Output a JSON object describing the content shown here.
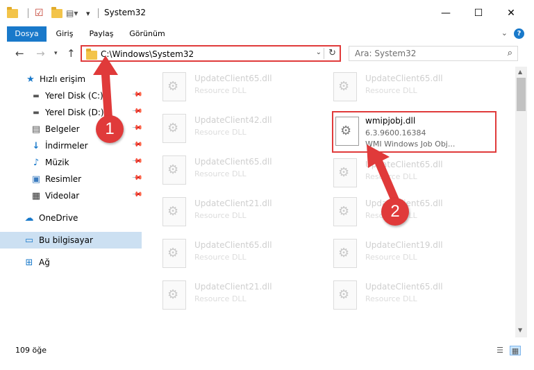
{
  "window": {
    "title": "System32",
    "minimize_glyph": "—",
    "maximize_glyph": "☐",
    "close_glyph": "✕"
  },
  "ribbon": {
    "tabs": [
      {
        "label": "Dosya",
        "active": true
      },
      {
        "label": "Giriş"
      },
      {
        "label": "Paylaş"
      },
      {
        "label": "Görünüm"
      }
    ],
    "help_glyph": "?",
    "collapse_glyph": "⌄"
  },
  "nav": {
    "address": "C:\\Windows\\System32",
    "search_placeholder": "Ara: System32"
  },
  "sidebar": {
    "items": [
      {
        "label": "Hızlı erişim",
        "icon": "star-icon",
        "pinned": false
      },
      {
        "label": "Yerel Disk (C:)",
        "icon": "drive-icon",
        "pinned": true
      },
      {
        "label": "Yerel Disk (D:)",
        "icon": "drive-icon",
        "pinned": true
      },
      {
        "label": "Belgeler",
        "icon": "documents-icon",
        "pinned": true
      },
      {
        "label": "İndirmeler",
        "icon": "download-icon",
        "pinned": true
      },
      {
        "label": "Müzik",
        "icon": "music-icon",
        "pinned": true
      },
      {
        "label": "Resimler",
        "icon": "pictures-icon",
        "pinned": true
      },
      {
        "label": "Videolar",
        "icon": "video-icon",
        "pinned": true
      },
      {
        "label": "OneDrive",
        "icon": "cloud-icon"
      },
      {
        "label": "Bu bilgisayar",
        "icon": "computer-icon",
        "selected": true
      },
      {
        "label": "Ağ",
        "icon": "network-icon"
      }
    ]
  },
  "files": [
    {
      "name": "UpdateClient65.dll",
      "desc": "Resource DLL"
    },
    {
      "name": "UpdateClient65.dll",
      "desc": "Resource DLL"
    },
    {
      "name": "UpdateClient42.dll",
      "desc": "Resource DLL"
    },
    {
      "name": "wmipjobj.dll",
      "version": "6.3.9600.16384",
      "desc": "WMI Windows Job Obj...",
      "highlighted": true
    },
    {
      "name": "UpdateClient65.dll",
      "desc": "Resource DLL"
    },
    {
      "name": "UpdateClient65.dll",
      "desc": "Resource DLL"
    },
    {
      "name": "UpdateClient21.dll",
      "desc": "Resource DLL"
    },
    {
      "name": "UpdateClient65.dll",
      "desc": "Resource DLL"
    },
    {
      "name": "UpdateClient65.dll",
      "desc": "Resource DLL"
    },
    {
      "name": "UpdateClient19.dll",
      "desc": "Resource DLL"
    },
    {
      "name": "UpdateClient21.dll",
      "desc": "Resource DLL"
    },
    {
      "name": "UpdateClient65.dll",
      "desc": "Resource DLL"
    }
  ],
  "status": {
    "item_count": "109 öğe"
  },
  "annotations": {
    "step1": "1",
    "step2": "2",
    "color": "#e03a3a"
  },
  "colors": {
    "accent": "#1979ca",
    "selection": "#cce0f2",
    "highlight_border": "#e03a3a"
  }
}
